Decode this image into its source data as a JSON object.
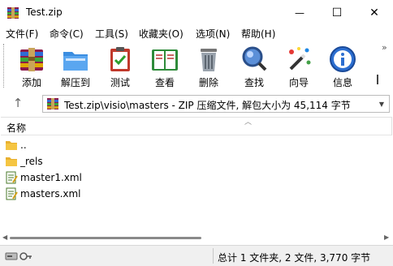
{
  "window": {
    "title": "Test.zip",
    "min_glyph": "—",
    "max_glyph": "☐",
    "close_glyph": "✕"
  },
  "menu": [
    {
      "label": "文件(F)"
    },
    {
      "label": "命令(C)"
    },
    {
      "label": "工具(S)"
    },
    {
      "label": "收藏夹(O)"
    },
    {
      "label": "选项(N)"
    },
    {
      "label": "帮助(H)"
    }
  ],
  "toolbar": [
    {
      "label": "添加",
      "icon": "books-add-icon"
    },
    {
      "label": "解压到",
      "icon": "folder-extract-icon"
    },
    {
      "label": "测试",
      "icon": "clipboard-check-icon"
    },
    {
      "label": "查看",
      "icon": "open-book-icon"
    },
    {
      "label": "删除",
      "icon": "trash-icon"
    },
    {
      "label": "查找",
      "icon": "magnifier-icon"
    },
    {
      "label": "向导",
      "icon": "magic-wand-icon"
    },
    {
      "label": "信息",
      "icon": "info-icon"
    }
  ],
  "toolbar_more": "»",
  "address": {
    "up_glyph": "↑",
    "path_text": "Test.zip\\visio\\masters - ZIP 压缩文件, 解包大小为 45,114 字节",
    "drop_glyph": "▼"
  },
  "filelist": {
    "column_name": "名称",
    "sort_glyph": "︿",
    "rows": [
      {
        "name": "..",
        "icon": "folder-icon"
      },
      {
        "name": "_rels",
        "icon": "folder-icon"
      },
      {
        "name": "master1.xml",
        "icon": "xml-file-icon"
      },
      {
        "name": "masters.xml",
        "icon": "xml-file-icon"
      }
    ]
  },
  "scrollbar": {
    "left_glyph": "◀",
    "right_glyph": "▶"
  },
  "status": {
    "text": "总计 1 文件夹, 2 文件, 3,770 字节"
  },
  "colors": {
    "accent_blue": "#1e6fd9",
    "folder_yellow": "#f5c542",
    "status_bg": "#f0f0f0"
  }
}
